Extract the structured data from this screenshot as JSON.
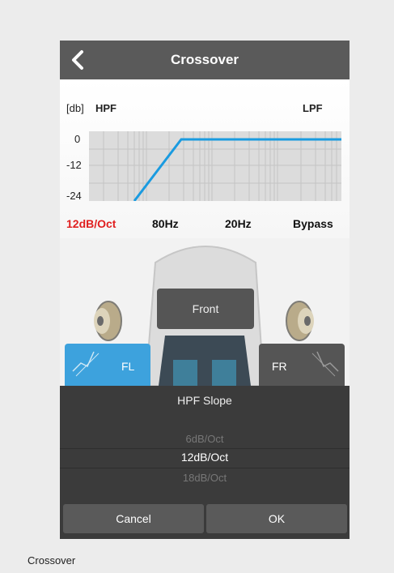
{
  "header": {
    "title": "Crossover",
    "back_icon": "chevron-left-icon"
  },
  "graph": {
    "db_label": "[db]",
    "hpf_label": "HPF",
    "lpf_label": "LPF",
    "y_ticks": [
      "0",
      "-12",
      "-24"
    ]
  },
  "values": {
    "slope": "12dB/Oct",
    "hpf_freq": "80Hz",
    "lpf_freq": "20Hz",
    "lpf_mode": "Bypass"
  },
  "car": {
    "front_label": "Front",
    "fl_label": "FL",
    "fr_label": "FR",
    "speaker_icon": "speaker-icon"
  },
  "picker": {
    "title": "HPF Slope",
    "options": [
      "6dB/Oct",
      "12dB/Oct",
      "18dB/Oct"
    ],
    "selected": "12dB/Oct",
    "cancel_label": "Cancel",
    "ok_label": "OK"
  },
  "caption": "Crossover",
  "colors": {
    "accent": "#3da2dd",
    "selected_value": "#e01f1f",
    "header": "#5a5a5a"
  }
}
